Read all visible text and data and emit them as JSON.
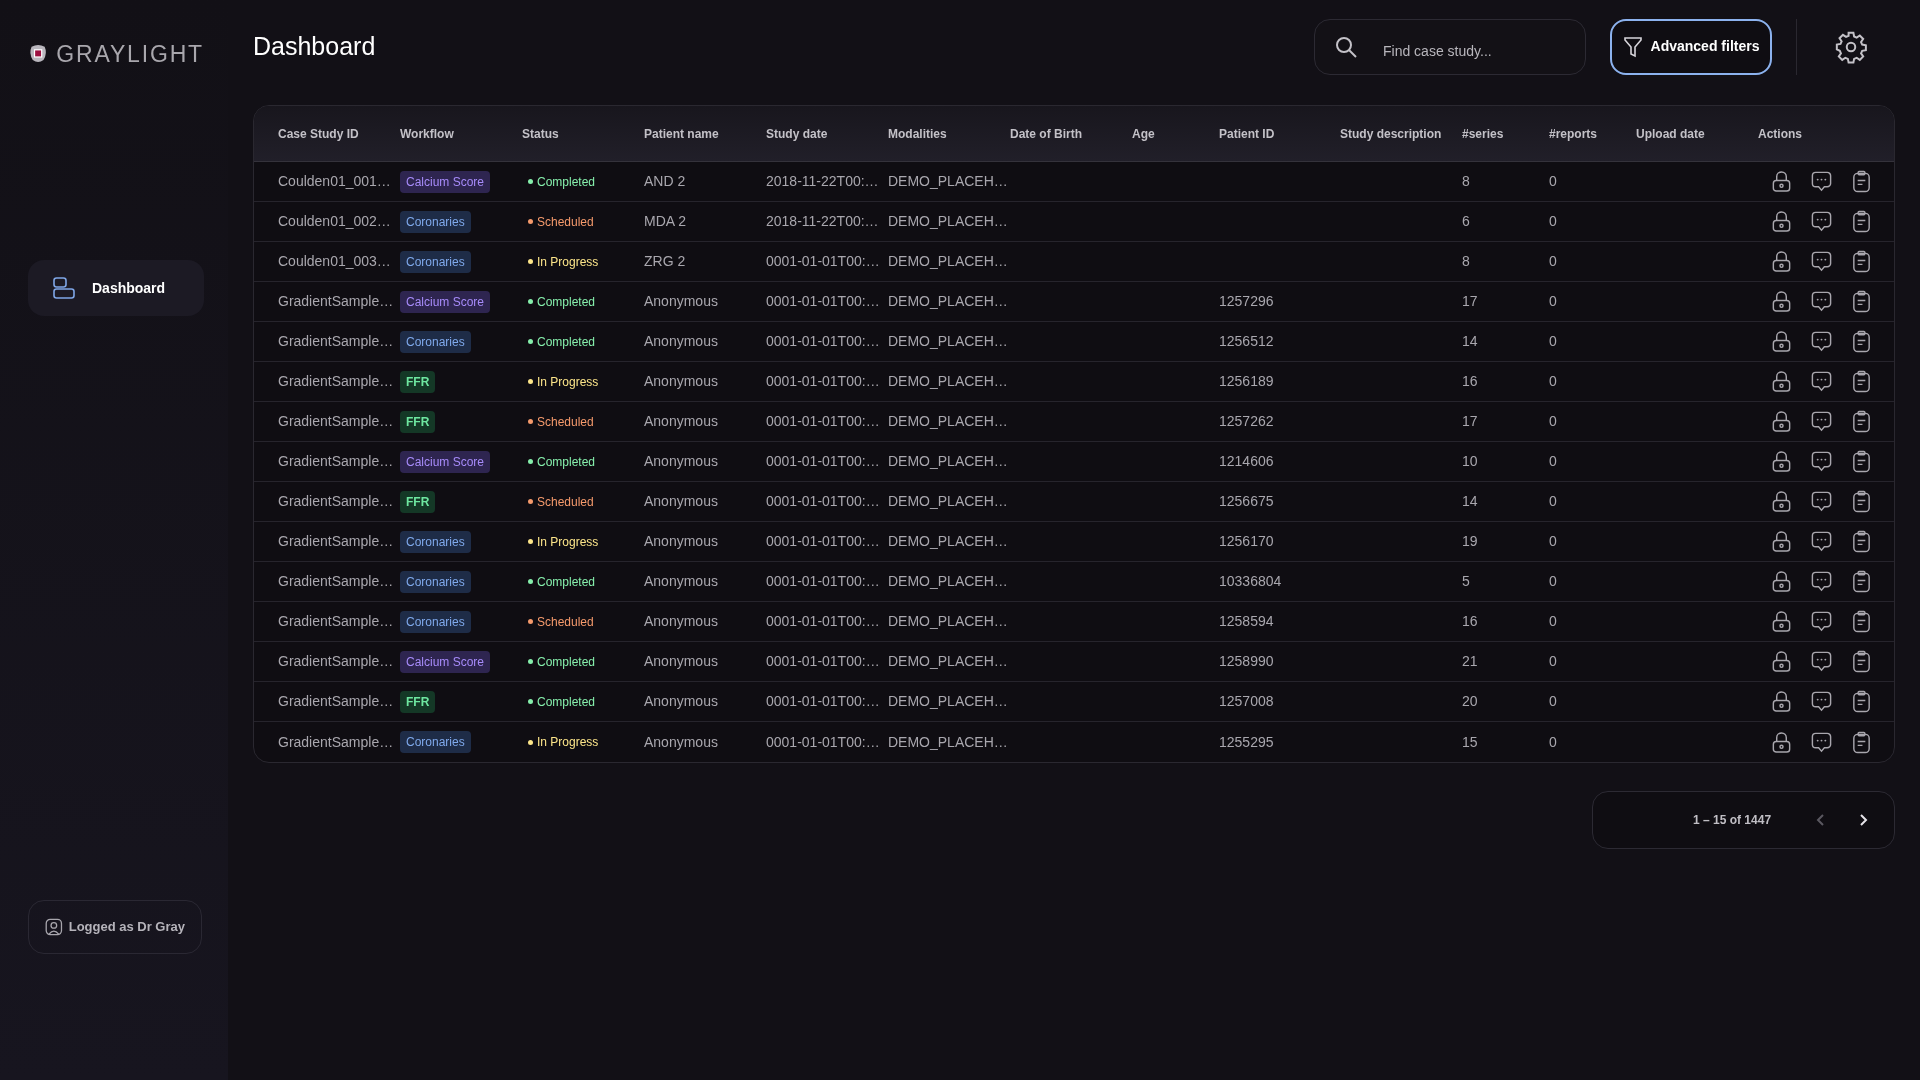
{
  "brand": "GRAYLIGHT",
  "page_title": "Dashboard",
  "search": {
    "placeholder": "Find case study..."
  },
  "filters_button": "Advanced filters",
  "sidebar": {
    "items": [
      {
        "label": "Dashboard",
        "selected": true
      }
    ]
  },
  "user": "Logged as Dr Gray",
  "table": {
    "columns": [
      "Case Study ID",
      "Workflow",
      "Status",
      "Patient name",
      "Study date",
      "Modalities",
      "Date of Birth",
      "Age",
      "Patient ID",
      "Study description",
      "#series",
      "#reports",
      "Upload date",
      "Actions"
    ],
    "rows": [
      {
        "case_id": "Coulden01_001…",
        "workflow": {
          "label": "Calcium Score",
          "kind": "calcium"
        },
        "status": {
          "label": "Completed",
          "kind": "completed"
        },
        "patient_name": "AND 2",
        "study_date": "2018-11-22T00:…",
        "modalities": "DEMO_PLACEH…",
        "series": "8",
        "reports": "0"
      },
      {
        "case_id": "Coulden01_002…",
        "workflow": {
          "label": "Coronaries",
          "kind": "coronaries"
        },
        "status": {
          "label": "Scheduled",
          "kind": "scheduled"
        },
        "patient_name": "MDA 2",
        "study_date": "2018-11-22T00:…",
        "modalities": "DEMO_PLACEH…",
        "series": "6",
        "reports": "0"
      },
      {
        "case_id": "Coulden01_003…",
        "workflow": {
          "label": "Coronaries",
          "kind": "coronaries"
        },
        "status": {
          "label": "In Progress",
          "kind": "in_progress"
        },
        "patient_name": "ZRG 2",
        "study_date": "0001-01-01T00:…",
        "modalities": "DEMO_PLACEH…",
        "series": "8",
        "reports": "0"
      },
      {
        "case_id": "GradientSample…",
        "workflow": {
          "label": "Calcium Score",
          "kind": "calcium"
        },
        "status": {
          "label": "Completed",
          "kind": "completed"
        },
        "patient_name": "Anonymous",
        "study_date": "0001-01-01T00:…",
        "modalities": "DEMO_PLACEH…",
        "patient_id": "1257296",
        "series": "17",
        "reports": "0"
      },
      {
        "case_id": "GradientSample…",
        "workflow": {
          "label": "Coronaries",
          "kind": "coronaries"
        },
        "status": {
          "label": "Completed",
          "kind": "completed"
        },
        "patient_name": "Anonymous",
        "study_date": "0001-01-01T00:…",
        "modalities": "DEMO_PLACEH…",
        "patient_id": "1256512",
        "series": "14",
        "reports": "0"
      },
      {
        "case_id": "GradientSample…",
        "workflow": {
          "label": "FFR",
          "kind": "ffr"
        },
        "status": {
          "label": "In Progress",
          "kind": "in_progress"
        },
        "patient_name": "Anonymous",
        "study_date": "0001-01-01T00:…",
        "modalities": "DEMO_PLACEH…",
        "patient_id": "1256189",
        "series": "16",
        "reports": "0"
      },
      {
        "case_id": "GradientSample…",
        "workflow": {
          "label": "FFR",
          "kind": "ffr"
        },
        "status": {
          "label": "Scheduled",
          "kind": "scheduled"
        },
        "patient_name": "Anonymous",
        "study_date": "0001-01-01T00:…",
        "modalities": "DEMO_PLACEH…",
        "patient_id": "1257262",
        "series": "17",
        "reports": "0"
      },
      {
        "case_id": "GradientSample…",
        "workflow": {
          "label": "Calcium Score",
          "kind": "calcium"
        },
        "status": {
          "label": "Completed",
          "kind": "completed"
        },
        "patient_name": "Anonymous",
        "study_date": "0001-01-01T00:…",
        "modalities": "DEMO_PLACEH…",
        "patient_id": "1214606",
        "series": "10",
        "reports": "0"
      },
      {
        "case_id": "GradientSample…",
        "workflow": {
          "label": "FFR",
          "kind": "ffr"
        },
        "status": {
          "label": "Scheduled",
          "kind": "scheduled"
        },
        "patient_name": "Anonymous",
        "study_date": "0001-01-01T00:…",
        "modalities": "DEMO_PLACEH…",
        "patient_id": "1256675",
        "series": "14",
        "reports": "0"
      },
      {
        "case_id": "GradientSample…",
        "workflow": {
          "label": "Coronaries",
          "kind": "coronaries"
        },
        "status": {
          "label": "In Progress",
          "kind": "in_progress"
        },
        "patient_name": "Anonymous",
        "study_date": "0001-01-01T00:…",
        "modalities": "DEMO_PLACEH…",
        "patient_id": "1256170",
        "series": "19",
        "reports": "0"
      },
      {
        "case_id": "GradientSample…",
        "workflow": {
          "label": "Coronaries",
          "kind": "coronaries"
        },
        "status": {
          "label": "Completed",
          "kind": "completed"
        },
        "patient_name": "Anonymous",
        "study_date": "0001-01-01T00:…",
        "modalities": "DEMO_PLACEH…",
        "patient_id": "10336804",
        "series": "5",
        "reports": "0"
      },
      {
        "case_id": "GradientSample…",
        "workflow": {
          "label": "Coronaries",
          "kind": "coronaries"
        },
        "status": {
          "label": "Scheduled",
          "kind": "scheduled"
        },
        "patient_name": "Anonymous",
        "study_date": "0001-01-01T00:…",
        "modalities": "DEMO_PLACEH…",
        "patient_id": "1258594",
        "series": "16",
        "reports": "0"
      },
      {
        "case_id": "GradientSample…",
        "workflow": {
          "label": "Calcium Score",
          "kind": "calcium"
        },
        "status": {
          "label": "Completed",
          "kind": "completed"
        },
        "patient_name": "Anonymous",
        "study_date": "0001-01-01T00:…",
        "modalities": "DEMO_PLACEH…",
        "patient_id": "1258990",
        "series": "21",
        "reports": "0"
      },
      {
        "case_id": "GradientSample…",
        "workflow": {
          "label": "FFR",
          "kind": "ffr"
        },
        "status": {
          "label": "Completed",
          "kind": "completed"
        },
        "patient_name": "Anonymous",
        "study_date": "0001-01-01T00:…",
        "modalities": "DEMO_PLACEH…",
        "patient_id": "1257008",
        "series": "20",
        "reports": "0"
      },
      {
        "case_id": "GradientSample…",
        "workflow": {
          "label": "Coronaries",
          "kind": "coronaries"
        },
        "status": {
          "label": "In Progress",
          "kind": "in_progress"
        },
        "patient_name": "Anonymous",
        "study_date": "0001-01-01T00:…",
        "modalities": "DEMO_PLACEH…",
        "patient_id": "1255295",
        "series": "15",
        "reports": "0"
      }
    ]
  },
  "pagination": {
    "range": "1 – 15 of 1447",
    "previous": {
      "disabled": true
    },
    "next": {
      "disabled": false
    }
  }
}
